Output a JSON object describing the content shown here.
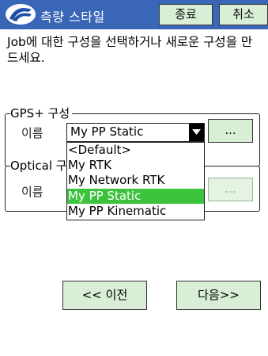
{
  "titlebar": {
    "title": "측량 스타일",
    "done_label": "종료",
    "cancel_label": "취소"
  },
  "instruction": "Job에 대한 구성을 선택하거나 새로운 구성을 만드세요.",
  "gps_group": {
    "legend": "GPS+ 구성",
    "name_label": "이름",
    "selected_value": "My PP Static",
    "browse_label": "..."
  },
  "optical_group": {
    "legend": "Optical 구",
    "name_label": "이름",
    "browse_label": "..."
  },
  "dropdown": {
    "options": [
      "<Default>",
      "My RTK",
      "My Network RTK",
      "My PP Static",
      "My PP Kinematic"
    ],
    "selected": "My PP Static"
  },
  "nav": {
    "prev_label": "<< 이전",
    "next_label": "다음>>"
  },
  "colors": {
    "titlebar": "#3a66b8",
    "button_bg": "#d8efd6",
    "selection": "#3dc23d"
  }
}
